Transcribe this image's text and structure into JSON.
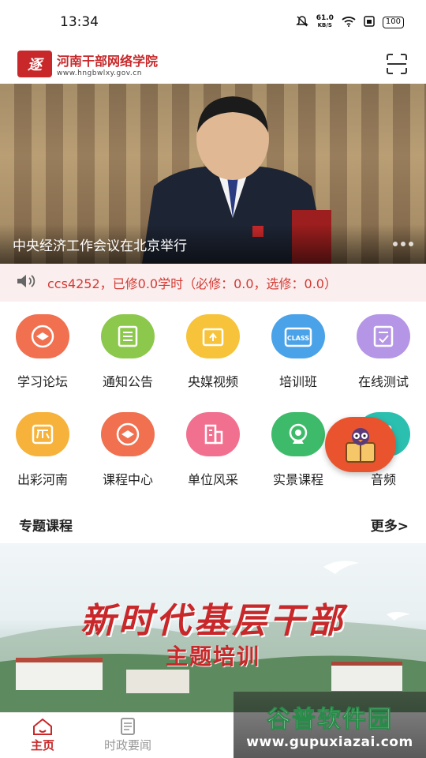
{
  "status_bar": {
    "time": "13:34",
    "net_speed_value": "61.0",
    "net_speed_unit": "KB/S",
    "battery": "100"
  },
  "header": {
    "logo_mark": "逐",
    "site_name": "河南干部网络学院",
    "site_url": "www.hngbwlxy.gov.cn"
  },
  "banner": {
    "caption": "中央经济工作会议在北京举行"
  },
  "notice": {
    "text": "ccs4252，已修0.0学时（必修：0.0，选修：0.0）"
  },
  "grid": {
    "items": [
      {
        "label": "学习论坛",
        "color": "#f0704f",
        "icon": "forum-icon"
      },
      {
        "label": "通知公告",
        "color": "#8cc84b",
        "icon": "notice-icon"
      },
      {
        "label": "央媒视频",
        "color": "#f6c33a",
        "icon": "video-icon"
      },
      {
        "label": "培训班",
        "color": "#4aa3e8",
        "icon": "class-icon"
      },
      {
        "label": "在线测试",
        "color": "#b595e6",
        "icon": "test-icon"
      },
      {
        "label": "出彩河南",
        "color": "#f6b23a",
        "icon": "henan-icon"
      },
      {
        "label": "课程中心",
        "color": "#f0704f",
        "icon": "course-icon"
      },
      {
        "label": "单位风采",
        "color": "#f2708f",
        "icon": "building-icon"
      },
      {
        "label": "实景课程",
        "color": "#3dbb6a",
        "icon": "camera-icon"
      },
      {
        "label": "音频",
        "color": "#2bbfb0",
        "icon": "audio-icon"
      }
    ],
    "class_badge": "CLASS"
  },
  "section": {
    "title": "专题课程",
    "more": "更多>"
  },
  "course_banner": {
    "line1": "新时代基层干部",
    "line2": "主题培训"
  },
  "tabbar": {
    "tabs": [
      {
        "label": "主页"
      },
      {
        "label": "时政要闻"
      }
    ]
  },
  "watermark": {
    "title": "谷普软件园",
    "url": "www.gupuxiazai.com"
  },
  "colors": {
    "brand_red": "#c8282a",
    "notice_red": "#d43a33"
  }
}
